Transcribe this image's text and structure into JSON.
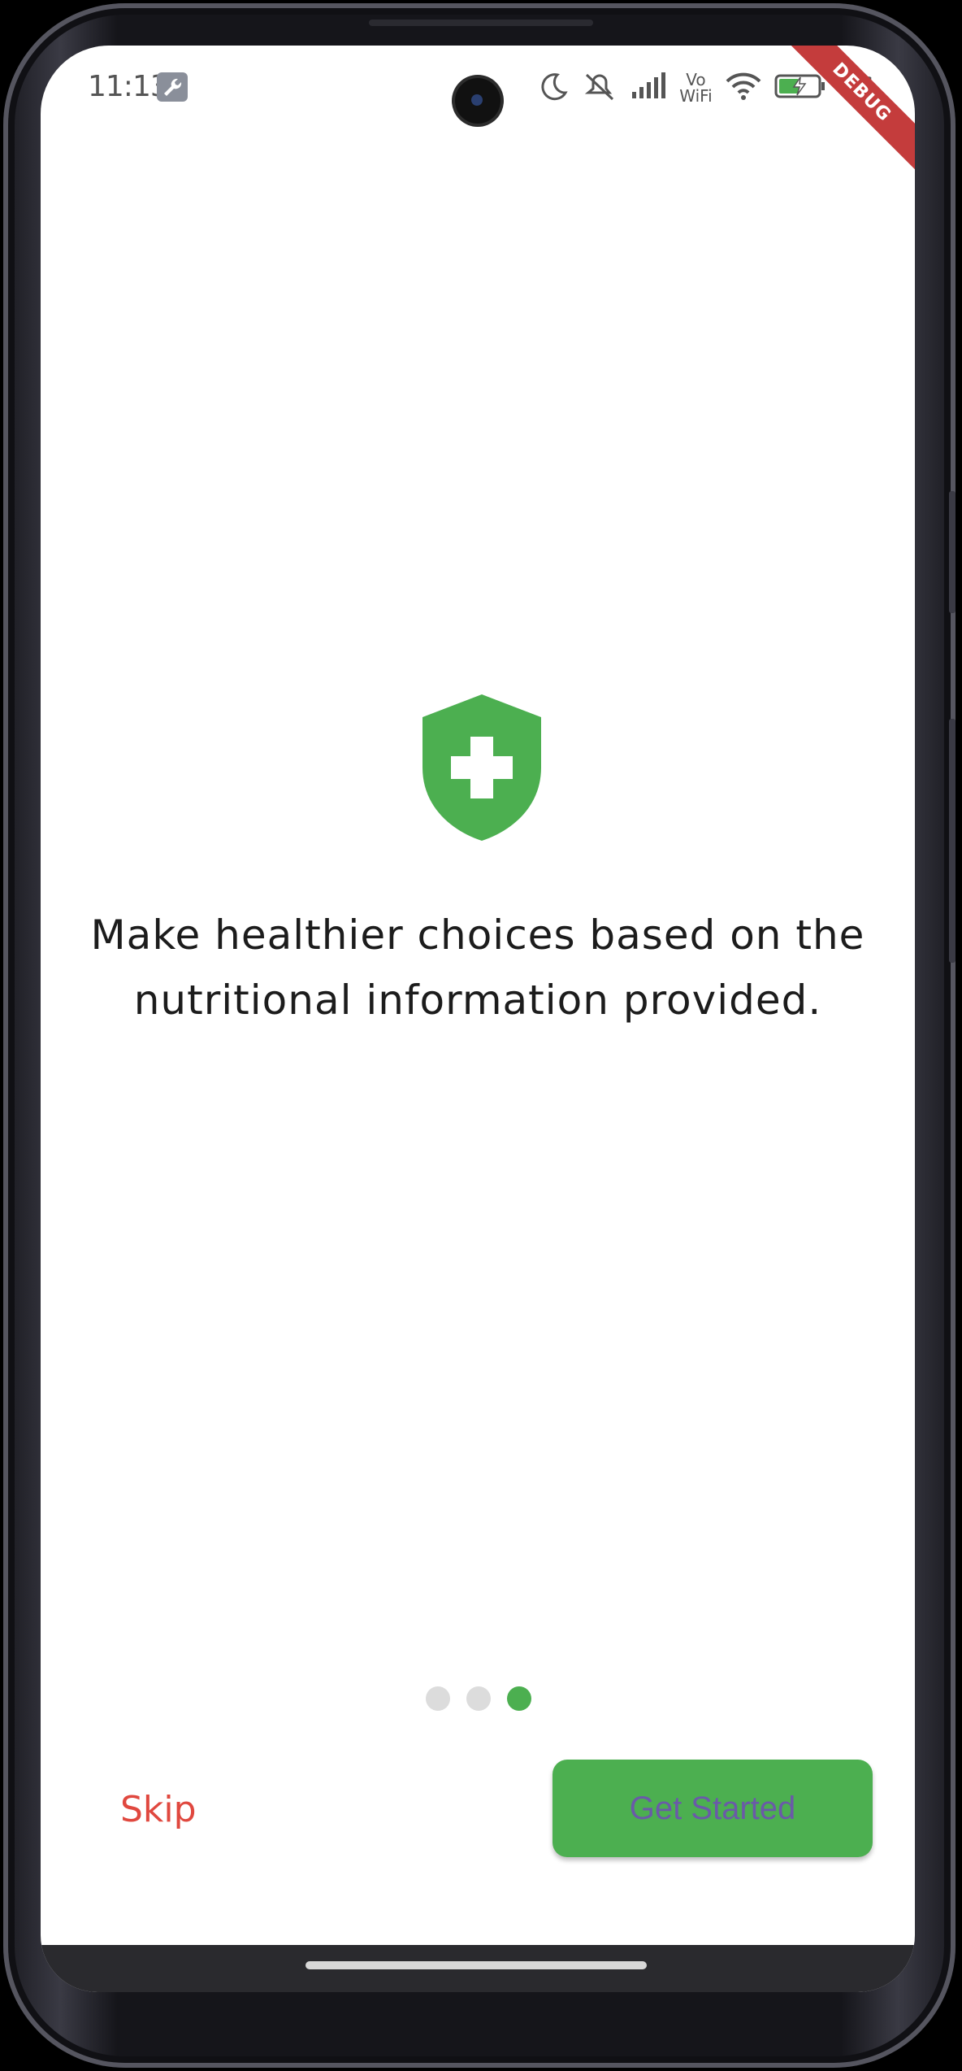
{
  "status_bar": {
    "time": "11:13",
    "battery_level": "46",
    "icons": [
      "wrench-icon",
      "moon-icon",
      "mute-icon",
      "signal-icon",
      "vowifi-icon",
      "wifi-icon",
      "battery-charging-icon"
    ],
    "vowifi_top": "Vo",
    "vowifi_bottom": "WiFi"
  },
  "debug_banner": "DEBUG",
  "onboarding": {
    "icon": "shield-plus-icon",
    "message": "Make healthier choices based on the nutritional information provided.",
    "page_indicator": {
      "total": 3,
      "current": 3
    }
  },
  "actions": {
    "skip_label": "Skip",
    "primary_label": "Get Started"
  },
  "colors": {
    "accent_green": "#4caf50",
    "skip_red": "#e0483f",
    "button_text": "#6a5aa8"
  }
}
